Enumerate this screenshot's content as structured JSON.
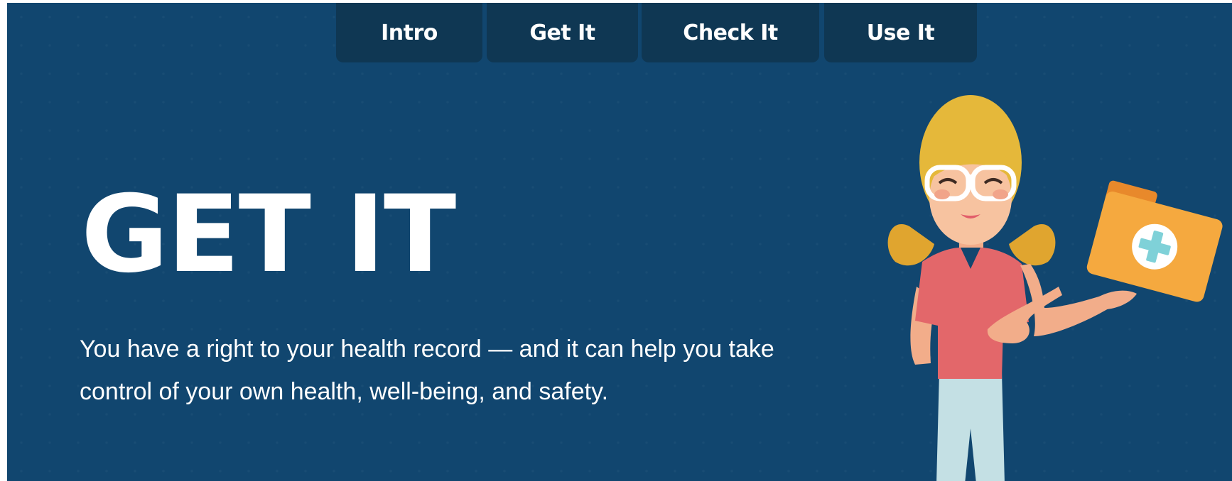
{
  "nav": {
    "tabs": [
      {
        "label": "Intro"
      },
      {
        "label": "Get It"
      },
      {
        "label": "Check It"
      },
      {
        "label": "Use It"
      }
    ]
  },
  "hero": {
    "title": "GET IT",
    "subtitle": "You have a right to your health record — and it can help you take control of your own health, well-being, and safety."
  },
  "illustration": {
    "icon": "woman-with-medical-folder-illustration"
  },
  "colors": {
    "background": "#11466f",
    "tab_background": "#0f3753",
    "text": "#ffffff",
    "hair": "#e5b83a",
    "shirt": "#e3676a",
    "folder": "#f5a93f",
    "cross": "#7fd1d8"
  }
}
